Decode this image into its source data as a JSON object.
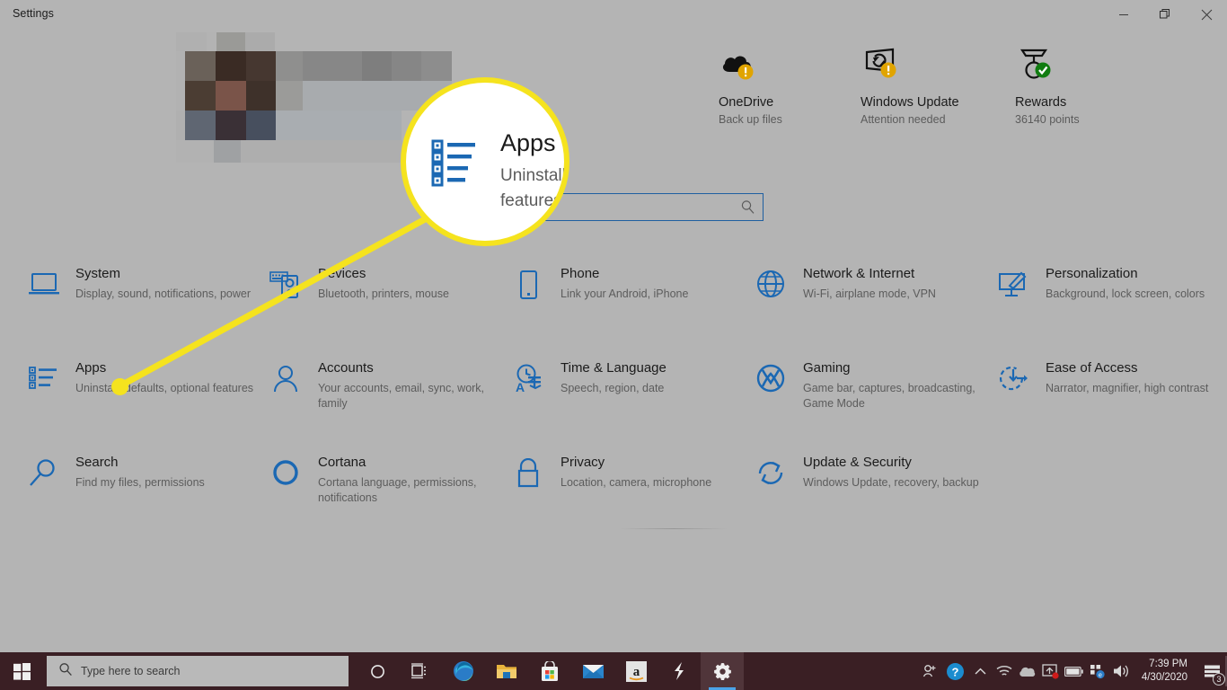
{
  "window": {
    "title": "Settings",
    "buttons": [
      {
        "name": "minimize-button",
        "label": "Minimize"
      },
      {
        "name": "restore-button",
        "label": "Restore"
      },
      {
        "name": "close-button",
        "label": "Close"
      }
    ]
  },
  "status_items": [
    {
      "title": "OneDrive",
      "sub": "Back up files",
      "icon": "onedrive-cloud-icon",
      "badge": "warning"
    },
    {
      "title": "Windows Update",
      "sub": "Attention needed",
      "icon": "windows-update-icon",
      "badge": "warning"
    },
    {
      "title": "Rewards",
      "sub": "36140 points",
      "icon": "rewards-medal-icon",
      "badge": "success"
    }
  ],
  "search": {
    "value": "",
    "placeholder": ""
  },
  "grid": [
    {
      "title": "System",
      "sub": "Display, sound, notifications, power",
      "icon": "laptop-icon"
    },
    {
      "title": "Devices",
      "sub": "Bluetooth, printers, mouse",
      "icon": "devices-icon"
    },
    {
      "title": "Phone",
      "sub": "Link your Android, iPhone",
      "icon": "phone-icon"
    },
    {
      "title": "Network & Internet",
      "sub": "Wi-Fi, airplane mode, VPN",
      "icon": "globe-icon"
    },
    {
      "title": "Personalization",
      "sub": "Background, lock screen, colors",
      "icon": "personalization-icon"
    },
    {
      "title": "Apps",
      "sub": "Uninstall, defaults, optional features",
      "icon": "apps-list-icon"
    },
    {
      "title": "Accounts",
      "sub": "Your accounts, email, sync, work, family",
      "icon": "person-icon"
    },
    {
      "title": "Time & Language",
      "sub": "Speech, region, date",
      "icon": "time-language-icon"
    },
    {
      "title": "Gaming",
      "sub": "Game bar, captures, broadcasting, Game Mode",
      "icon": "xbox-icon"
    },
    {
      "title": "Ease of Access",
      "sub": "Narrator, magnifier, high contrast",
      "icon": "ease-of-access-icon"
    },
    {
      "title": "Search",
      "sub": "Find my files, permissions",
      "icon": "search-magnifier-icon"
    },
    {
      "title": "Cortana",
      "sub": "Cortana language, permissions, notifications",
      "icon": "cortana-ring-icon"
    },
    {
      "title": "Privacy",
      "sub": "Location, camera, microphone",
      "icon": "lock-icon"
    },
    {
      "title": "Update & Security",
      "sub": "Windows Update, recovery, backup",
      "icon": "sync-arrows-icon"
    }
  ],
  "callout": {
    "title": "Apps",
    "sub": "Uninstall, features",
    "highlight_color": "#f5e31e",
    "icon": "apps-list-icon"
  },
  "taskbar": {
    "search_placeholder": "Type here to search",
    "icons": [
      {
        "name": "cortana-taskbar-icon"
      },
      {
        "name": "task-view-icon"
      },
      {
        "name": "microsoft-edge-icon"
      },
      {
        "name": "file-explorer-icon"
      },
      {
        "name": "microsoft-store-icon"
      },
      {
        "name": "mail-icon"
      },
      {
        "name": "amazon-icon"
      },
      {
        "name": "lightning-app-icon"
      },
      {
        "name": "settings-gear-icon",
        "active": true
      }
    ],
    "tray": [
      {
        "name": "people-icon"
      },
      {
        "name": "help-circle-icon"
      },
      {
        "name": "show-hidden-icons-chevron"
      },
      {
        "name": "wifi-icon"
      },
      {
        "name": "onedrive-tray-icon"
      },
      {
        "name": "display-update-icon"
      },
      {
        "name": "battery-icon"
      },
      {
        "name": "network-share-icon"
      },
      {
        "name": "volume-icon"
      }
    ],
    "clock_time": "7:39 PM",
    "clock_date": "4/30/2020",
    "notification_count": "3"
  },
  "colors": {
    "window_bg": "#b4b4b4",
    "accent_blue": "#1b68b3",
    "taskbar": "#3a1f24",
    "highlight": "#f5e31e"
  }
}
